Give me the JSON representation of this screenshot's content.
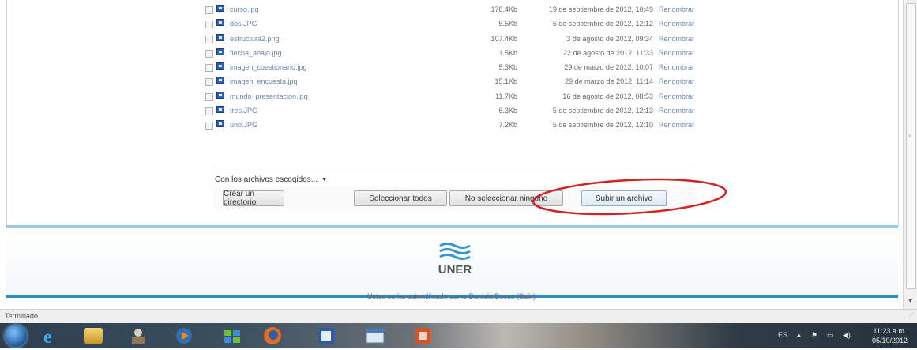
{
  "files": [
    {
      "name": "curso.jpg",
      "size": "178.4Kb",
      "date": "19 de septiembre de 2012, 10:49",
      "action": "Renombrar"
    },
    {
      "name": "dos.JPG",
      "size": "5.5Kb",
      "date": "5 de septiembre de 2012, 12:12",
      "action": "Renombrar"
    },
    {
      "name": "estructura2.png",
      "size": "107.4Kb",
      "date": "3 de agosto de 2012, 09:34",
      "action": "Renombrar"
    },
    {
      "name": "flecha_abajo.jpg",
      "size": "1.5Kb",
      "date": "22 de agosto de 2012, 11:33",
      "action": "Renombrar"
    },
    {
      "name": "imagen_cuestionario.jpg",
      "size": "5.3Kb",
      "date": "29 de marzo de 2012, 10:07",
      "action": "Renombrar"
    },
    {
      "name": "imagen_encuesta.jpg",
      "size": "15.1Kb",
      "date": "29 de marzo de 2012, 11:14",
      "action": "Renombrar"
    },
    {
      "name": "mundo_presentacion.jpg",
      "size": "11.7Kb",
      "date": "16 de agosto de 2012, 08:53",
      "action": "Renombrar"
    },
    {
      "name": "tres.JPG",
      "size": "6.3Kb",
      "date": "5 de septiembre de 2012, 12:13",
      "action": "Renombrar"
    },
    {
      "name": "uno.JPG",
      "size": "7.2Kb",
      "date": "5 de septiembre de 2012, 12:10",
      "action": "Renombrar"
    }
  ],
  "selection_action": "Con los archivos escogidos...",
  "buttons": {
    "create_dir": "Crear un directorio",
    "select_all": "Seleccionar todos",
    "select_none": "No seleccionar ninguno",
    "upload": "Subir un archivo"
  },
  "footer": {
    "logo_text": "UNER",
    "login_info": "Usted se ha autentificado como Daniela Bosco (Salir)"
  },
  "statusbar": {
    "status": "Terminado"
  },
  "tray": {
    "language": "ES",
    "time": "11:23 a.m.",
    "date": "05/10/2012"
  },
  "colors": {
    "annotation_circle": "#d22222",
    "footer_accent": "#2f89c4"
  }
}
